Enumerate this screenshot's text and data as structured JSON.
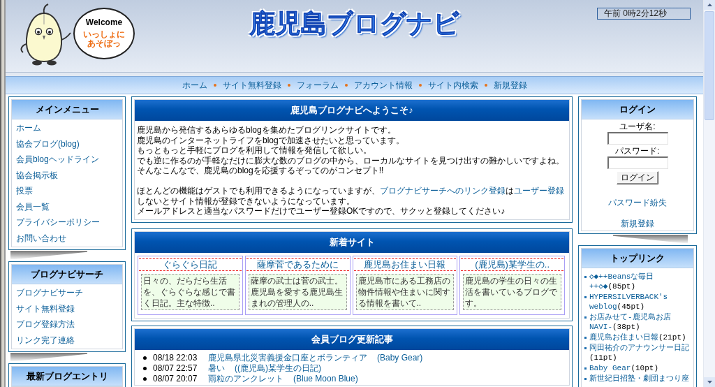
{
  "header": {
    "mascot_bubble": {
      "greeting": "Welcome",
      "lines": [
        "いっしょに",
        "あそぼっ"
      ]
    },
    "logo_title": "鹿児島ブログナビ",
    "clock": "午前 0時2分12秒"
  },
  "nav": [
    "ホーム",
    "サイト無料登録",
    "フォーラム",
    "アカウント情報",
    "サイト内検索",
    "新規登録"
  ],
  "left_sidebar": [
    {
      "title": "メインメニュー",
      "items": [
        "ホーム",
        "協会ブログ(blog)",
        "会員blogヘッドライン",
        "協会掲示板",
        "投票",
        "会員一覧",
        "プライバシーポリシー",
        "お問い合わせ"
      ]
    },
    {
      "title": "ブログナビサーチ",
      "items": [
        "ブログナビサーチ",
        "サイト無料登録",
        "ブログ登録方法",
        "リンク完了連絡"
      ]
    },
    {
      "title": "最新ブログエントリ"
    }
  ],
  "welcome": {
    "title": "鹿児島ブログナビへようこそ♪",
    "intro_lines": [
      "鹿児島から発信するあらゆるblogを集めたブログリンクサイトです。",
      "鹿児島のインターネットライフをblogで加速させたいと思っています。",
      "もっともっと手軽にブログを利用して情報を発信して欲しい。",
      "でも逆に作るのが手軽なだけに膨大な数のブログの中から、ローカルなサイトを見つけ出すの難かしいですよね。",
      "そんなこんなで、鹿児島のblogを応援するぞってのがコンセプト!!"
    ],
    "note": [
      {
        "kind": "text",
        "text": "ほとんどの機能はゲストでも利用できるようになっていますが、"
      },
      {
        "kind": "link",
        "text": "ブログナビサーチへのリンク登録"
      },
      {
        "kind": "text",
        "text": "は"
      },
      {
        "kind": "link",
        "text": "ユーザー登録"
      },
      {
        "kind": "text",
        "text": "しないとサイト情報が登録できないようになっています。"
      }
    ],
    "closing": "メールアドレスと適当なパスワードだけでユーザー登録OKですので、サクッと登録してください♪"
  },
  "new_sites": {
    "title": "新着サイト",
    "sites": [
      {
        "name": "ぐらぐら日記",
        "description": "日々の、だらだら生活を、ぐらぐらな感じで書く日記。主な特徴.."
      },
      {
        "name": "薩摩菅であるために",
        "description": "薩摩の武士は菅の武士。鹿児島を愛する鹿児島生まれの管理人の.."
      },
      {
        "name": "鹿児島お住まい日報",
        "description": "鹿児島市にある工務店の物件情報や住まいに関する情報を書いて.."
      },
      {
        "name": "(鹿児島)某学生の..",
        "description": "鹿児島の学生の日々の生活を書いているブログです。"
      }
    ]
  },
  "member_blogs": {
    "title": "会員ブログ更新記事",
    "entries": [
      {
        "time": "08/18 22:03",
        "title": "鹿児島県北災害義援金口座とボランティア",
        "blog": "(Baby Gear)"
      },
      {
        "time": "08/07 22:57",
        "title": "暑い",
        "blog": "((鹿児島)某学生の日記)"
      },
      {
        "time": "08/07 20:07",
        "title": "雨粒のアンクレット",
        "blog": "(Blue Moon Blue)"
      }
    ]
  },
  "login": {
    "title": "ログイン",
    "username_label": "ユーザ名:",
    "password_label": "パスワード:",
    "button": "ログイン",
    "links": [
      "パスワード紛失",
      "新規登録"
    ]
  },
  "top_links": {
    "title": "トップリンク",
    "items": [
      {
        "name": "◇◆++Beansな毎日++◇◆",
        "points": "(85pt)"
      },
      {
        "name": "HYPERSILVERBACK's weblog",
        "points": "(45pt)"
      },
      {
        "name": "お店みせて-鹿児島お店NAVI-",
        "points": "(38pt)"
      },
      {
        "name": "鹿児島お住まい日報",
        "points": "(21pt)"
      },
      {
        "name": "岡田祐介のアナウンサー日記",
        "points": "(11pt)"
      },
      {
        "name": "Baby Gear",
        "points": "(10pt)"
      },
      {
        "name": "新世紀日招塾・劇団まつり座"
      }
    ]
  }
}
